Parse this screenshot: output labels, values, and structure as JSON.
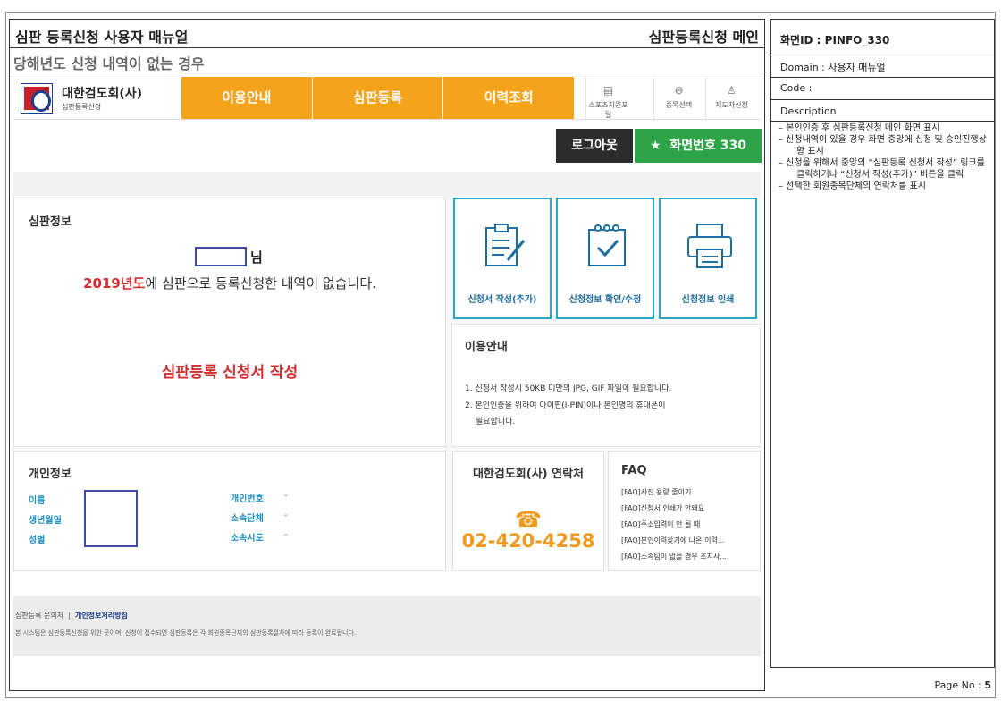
{
  "doc": {
    "title": "심판 등록신청 사용자 매뉴얼",
    "screen_name": "심판등록신청 메인",
    "case_title": "당해년도 신청 내역이 없는 경우"
  },
  "site": {
    "org_name": "대한검도회(사)",
    "org_sub": "심판등록신청",
    "nav": [
      "이용안내",
      "심판등록",
      "이력조회"
    ],
    "utils": [
      {
        "icon": "document-icon",
        "label": "스포츠지원포털"
      },
      {
        "icon": "circle-icon",
        "label": "종목선택"
      },
      {
        "icon": "person-icon",
        "label": "지도자신청"
      }
    ],
    "logout_label": "로그아웃",
    "screen_no_label": "화면번호 330"
  },
  "judge_info": {
    "title": "심판정보",
    "suffix": "님",
    "year": "2019년도",
    "message_rest": "에 심판으로 등록신청한 내역이 없습니다.",
    "write_link": "심판등록 신청서 작성"
  },
  "actions": [
    {
      "label": "신청서 작성(추가)",
      "icon": "clipboard-icon"
    },
    {
      "label": "신청정보 확인/수정",
      "icon": "checklist-icon"
    },
    {
      "label": "신청정보 인쇄",
      "icon": "printer-icon"
    }
  ],
  "guide": {
    "title": "이용안내",
    "line1": "1. 신청서 작성시 50KB 미만의 JPG, GIF 파일이 필요합니다.",
    "line2": "2. 본인인증을 위하여 아이핀(I-PIN)이나 본인명의 휴대폰이",
    "line3": "필요합니다."
  },
  "personal": {
    "title": "개인정보",
    "left_labels": [
      "이름",
      "생년월일",
      "성별"
    ],
    "right_labels": [
      "개인번호",
      "소속단체",
      "소속시도"
    ],
    "right_values": [
      "-",
      "-",
      "-"
    ]
  },
  "contact": {
    "title": "대한검도회(사) 연락처",
    "phone": "02-420-4258"
  },
  "faq": {
    "title": "FAQ",
    "items": [
      "[FAQ]사진 용량 줄이기",
      "[FAQ]신청서 인쇄가 안돼요",
      "[FAQ]주소입력이 안 될 때",
      "[FAQ]본인이력찾기에 나온 이력...",
      "[FAQ]소속팀이 없을 경우 조치사..."
    ]
  },
  "footer": {
    "links": "심판등록 문의처",
    "privacy": "개인정보처리방침",
    "notice": "본 시스템은 심판등록신청을 위한 곳이며, 신청이 접수되면 심판등록은 각 회원종목단체의 심판등록절차에 따라 등록이 완료됩니다."
  },
  "side": {
    "screen_id": "화면ID : PINFO_330",
    "domain": "Domain : 사용자 매뉴얼",
    "code": "Code :",
    "desc_label": "Description",
    "descriptions": [
      "–   본인인증 후 심판등록신청 메인 화면 표시",
      "–   신청내역이 있을 경우 화면 중앙에 신청 및 승인진행상황 표시",
      "–   신청을 위해서 중앙의 “심판등록 신청서 작성” 링크를 클릭하거나 “신청서 작성(추가)” 버튼을 클릭",
      "–   선택한 회원종목단체의 연락처를 표시"
    ],
    "page_label": "Page No : ",
    "page_no": "5"
  },
  "colors": {
    "nav_orange": "#f4a31b",
    "green": "#2ea347",
    "alert_red": "#d12f2f",
    "accent_blue": "#1f8fc3"
  }
}
